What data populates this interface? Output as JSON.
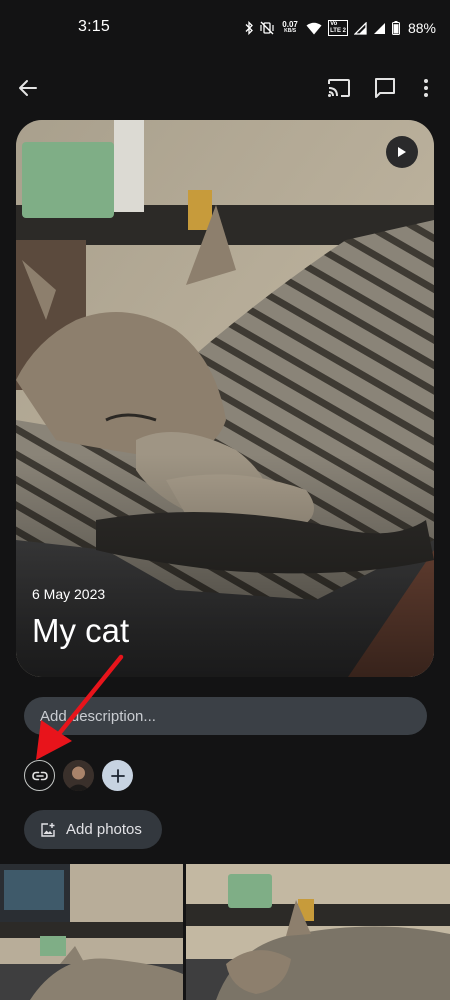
{
  "status_bar": {
    "time": "3:15",
    "net_speed_value": "0.07",
    "net_speed_unit": "KB/S",
    "volte_label_1": "Vo",
    "volte_label_2": "LTE 2",
    "battery": "88%"
  },
  "toolbar": {
    "icons": [
      "back-arrow-icon",
      "cast-icon",
      "comment-icon",
      "more-vert-icon"
    ]
  },
  "album": {
    "date": "6 May 2023",
    "title": "My cat",
    "description_placeholder": "Add description...",
    "add_photos_label": "Add photos"
  },
  "colors": {
    "background": "#131314",
    "field": "#3b4046",
    "add_person_bg": "#c7d3e1",
    "annotation_arrow": "#e8141b"
  }
}
